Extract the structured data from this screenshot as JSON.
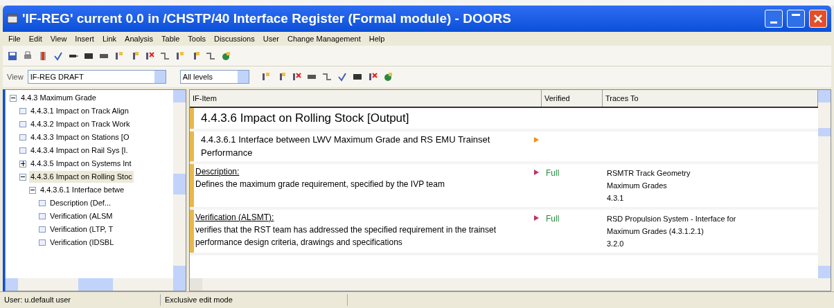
{
  "window": {
    "title": "'IF-REG' current 0.0 in /CHSTP/40 Interface Register (Formal module) - DOORS"
  },
  "menu": [
    "File",
    "Edit",
    "View",
    "Insert",
    "Link",
    "Analysis",
    "Table",
    "Tools",
    "Discussions",
    "User",
    "Change Management",
    "Help"
  ],
  "view_bar": {
    "label": "View",
    "view": "IF-REG DRAFT",
    "level": "All levels"
  },
  "tree": [
    {
      "label": "4.4.3 Maximum Grade",
      "expanded": true,
      "selected": false,
      "children": [
        {
          "label": "4.4.3.1 Impact on Track Align",
          "selected": false
        },
        {
          "label": "4.4.3.2 Impact on Track Work",
          "selected": false
        },
        {
          "label": "4.4.3.3 Impact on Stations [O",
          "selected": false
        },
        {
          "label": "4.4.3.4 Impact on Rail Sys [I.",
          "selected": false
        },
        {
          "label": "4.4.3.5 Impact on Systems Int",
          "expanded": false,
          "selected": false
        },
        {
          "label": "4.4.3.6 Impact on Rolling Stoc",
          "expanded": true,
          "selected": true,
          "children": [
            {
              "label": "4.4.3.6.1 Interface betwe",
              "expanded": true,
              "selected": false,
              "children": [
                {
                  "label": "Description (Def...",
                  "selected": false
                },
                {
                  "label": "Verification (ALSM",
                  "selected": false
                },
                {
                  "label": "Verification (LTP, T",
                  "selected": false
                },
                {
                  "label": "Verification (IDSBL",
                  "selected": false
                }
              ]
            }
          ]
        }
      ]
    }
  ],
  "table": {
    "columns": [
      "IF-Item",
      "Verified",
      "Traces To"
    ],
    "rows": [
      {
        "kind": "heading",
        "text": "4.4.3.6 Impact on Rolling Stock [Output]"
      },
      {
        "kind": "subheading",
        "text": "4.4.3.6.1 Interface between LWV Maximum Grade and RS EMU Trainset Performance",
        "color": "#f09010"
      },
      {
        "kind": "object",
        "title": "Description:",
        "text": "Defines the maximum grade requirement, specified by the IVP team",
        "color": "#c0306a",
        "verified": "Full",
        "traces": [
          "RSMTR Track Geometry",
          "Maximum Grades",
          "4.3.1"
        ]
      },
      {
        "kind": "object",
        "title": "Verification (ALSMT):",
        "text": "verifies that the RST team has addressed the specified requirement in the trainset performance design criteria, drawings and specifications",
        "color": "#c0306a",
        "verified": "Full",
        "traces": [
          "RSD Propulsion System - Interface for",
          "Maximum Grades (4.3.1.2.1)",
          "3.2.0"
        ]
      }
    ]
  },
  "status_bar": [
    "User: u.default user",
    "Exclusive edit mode"
  ]
}
